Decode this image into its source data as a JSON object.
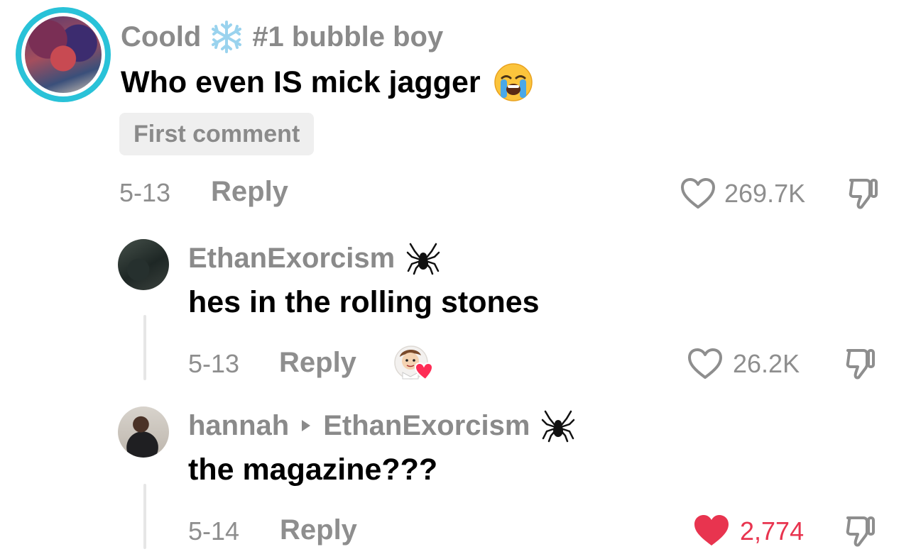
{
  "main_comment": {
    "username": "Coold",
    "username_suffix": "#1 bubble boy",
    "text": "Who even IS mick jagger",
    "tag": "First comment",
    "date": "5-13",
    "reply_label": "Reply",
    "likes": "269.7K"
  },
  "replies": [
    {
      "username": "EthanExorcism",
      "text": "hes in the rolling stones",
      "date": "5-13",
      "reply_label": "Reply",
      "likes": "26.2K",
      "liked": false
    },
    {
      "username": "hannah",
      "reply_to": "EthanExorcism",
      "text": "the magazine???",
      "date": "5-14",
      "reply_label": "Reply",
      "likes": "2,774",
      "liked": true
    }
  ],
  "icons": {
    "snowflake": "snowflake-icon",
    "crying_face": "loudly-crying-face-icon",
    "spider": "spider-icon",
    "heart_outline": "heart-outline-icon",
    "heart_filled": "heart-filled-icon",
    "dislike": "thumbs-down-icon",
    "creator_liked": "creator-liked-badge-icon",
    "reply_arrow": "triangle-right-icon"
  },
  "colors": {
    "accent_ring": "#29c2d8",
    "liked_red": "#e8344f",
    "muted_gray": "#8e8e8e"
  }
}
